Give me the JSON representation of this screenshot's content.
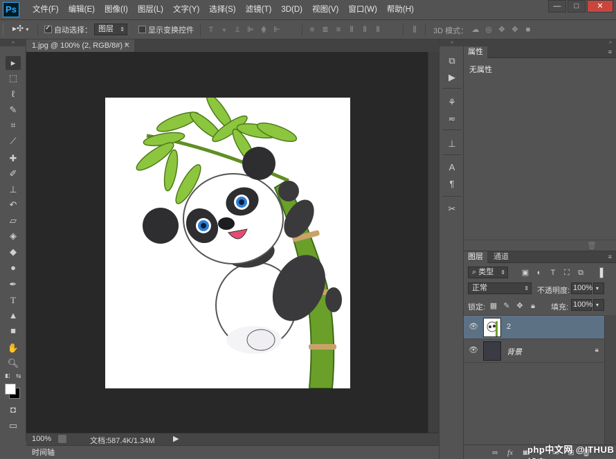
{
  "app": {
    "logo": "Ps"
  },
  "menu": [
    "文件(F)",
    "编辑(E)",
    "图像(I)",
    "图层(L)",
    "文字(Y)",
    "选择(S)",
    "滤镜(T)",
    "3D(D)",
    "视图(V)",
    "窗口(W)",
    "帮助(H)"
  ],
  "window_controls": {
    "minimize": "—",
    "restore": "□",
    "close": "✕"
  },
  "options": {
    "auto_select_label": "自动选择：",
    "auto_select_checked": true,
    "auto_select_target": "图层",
    "show_transform_label": "显示变换控件",
    "mode_3d_label": "3D 模式："
  },
  "document": {
    "tab_title": "1.jpg @ 100% (2, RGB/8#) *",
    "zoom": "100%",
    "doc_size": "文档:587.4K/1.34M",
    "timeline_label": "时间轴"
  },
  "properties_panel": {
    "tab": "属性",
    "content": "无属性"
  },
  "layers_panel": {
    "tabs": [
      "图层",
      "通道"
    ],
    "filter_kind": "类型",
    "blend_mode": "正常",
    "opacity_label": "不透明度:",
    "opacity_value": "100%",
    "lock_label": "锁定:",
    "fill_label": "填充:",
    "fill_value": "100%",
    "layers": [
      {
        "name": "2",
        "selected": true,
        "visible": true
      },
      {
        "name": "背景",
        "selected": false,
        "visible": true,
        "locked": true
      }
    ],
    "footer_icons": [
      "link-icon",
      "fx-icon",
      "mask-icon",
      "adjustment-icon",
      "group-icon",
      "new-layer-icon",
      "trash-icon"
    ]
  },
  "colors": {
    "selected_layer": "#5d7185",
    "canvas_bg": "#282828",
    "ui_bg": "#535353"
  },
  "watermark": "php中文网 @ITHUB博客"
}
